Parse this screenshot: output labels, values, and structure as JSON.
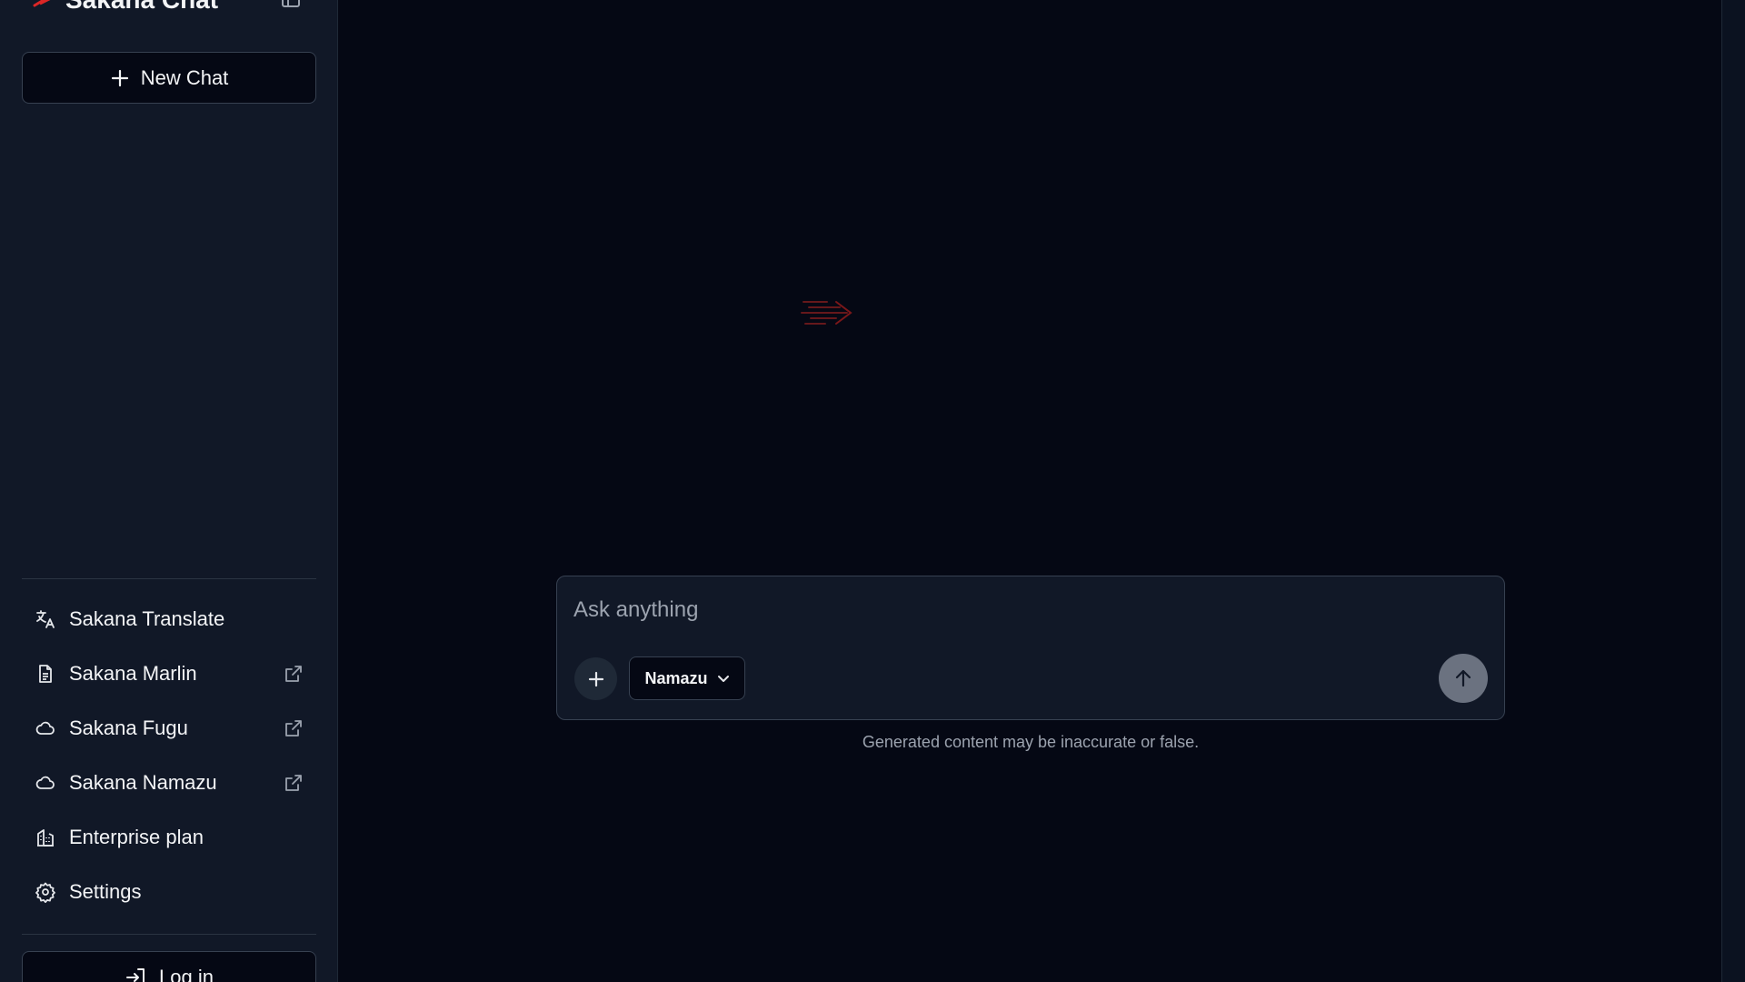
{
  "sidebar": {
    "brand_name": "Sakana Chat",
    "new_chat_label": "New Chat",
    "nav_items": [
      {
        "label": "Sakana Translate",
        "icon": "translate-icon",
        "external": false
      },
      {
        "label": "Sakana Marlin",
        "icon": "document-icon",
        "external": true
      },
      {
        "label": "Sakana Fugu",
        "icon": "cloud-icon",
        "external": true
      },
      {
        "label": "Sakana Namazu",
        "icon": "cloud-icon",
        "external": true
      },
      {
        "label": "Enterprise plan",
        "icon": "building-icon",
        "external": false
      },
      {
        "label": "Settings",
        "icon": "gear-icon",
        "external": false
      }
    ],
    "login_label": "Log in"
  },
  "composer": {
    "placeholder": "Ask anything",
    "value": "",
    "model": "Namazu",
    "attach_icon": "plus-icon",
    "send_icon": "arrow-up-icon"
  },
  "disclaimer": "Generated content may be inaccurate or false.",
  "colors": {
    "background": "#050814",
    "sidebar": "#111827",
    "border": "#374151",
    "brand_accent": "#dc2626",
    "send_button": "#6b7280",
    "muted_text": "#9ca3af"
  }
}
